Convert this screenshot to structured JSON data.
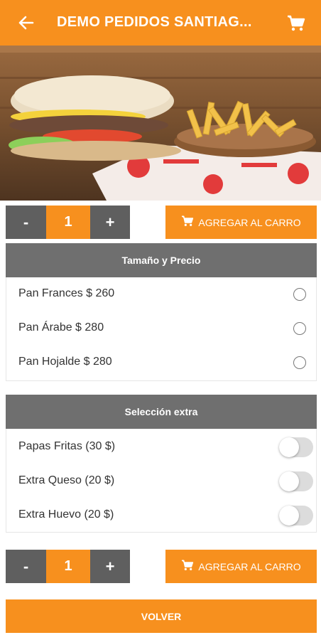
{
  "header": {
    "title": "DEMO PEDIDOS SANTIAG...",
    "back_icon": "arrow-left-icon",
    "cart_icon": "cart-icon"
  },
  "colors": {
    "accent": "#f7901e",
    "dark_button": "#5f5f5f",
    "section_header": "#6f6f6f"
  },
  "order_top": {
    "minus_label": "-",
    "quantity": "1",
    "plus_label": "+",
    "add_label": "AGREGAR AL CARRO"
  },
  "size_price": {
    "title": "Tamaño y Precio",
    "options": [
      {
        "label": "Pan Frances $ 260",
        "selected": false
      },
      {
        "label": "Pan Árabe $ 280",
        "selected": false
      },
      {
        "label": "Pan Hojalde $ 280",
        "selected": false
      }
    ]
  },
  "extras": {
    "title": "Selección extra",
    "options": [
      {
        "label": "Papas Fritas (30 $)",
        "enabled": false
      },
      {
        "label": "Extra Queso (20 $)",
        "enabled": false
      },
      {
        "label": "Extra Huevo (20 $)",
        "enabled": false
      }
    ]
  },
  "order_bottom": {
    "minus_label": "-",
    "quantity": "1",
    "plus_label": "+",
    "add_label": "AGREGAR AL CARRO"
  },
  "footer": {
    "back_label": "VOLVER"
  }
}
